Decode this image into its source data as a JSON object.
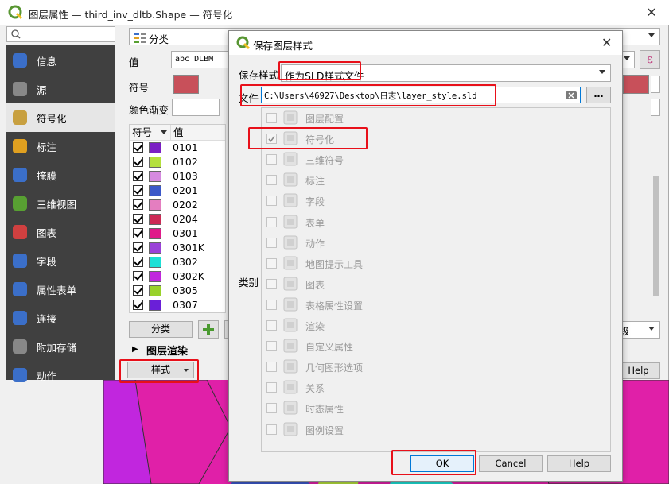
{
  "main_window": {
    "title": "图层属性 — third_inv_dltb.Shape — 符号化",
    "sidebar": [
      {
        "label": "信息",
        "icon": "info-icon"
      },
      {
        "label": "源",
        "icon": "source-icon"
      },
      {
        "label": "符号化",
        "icon": "symbology-icon",
        "selected": true
      },
      {
        "label": "标注",
        "icon": "labels-icon"
      },
      {
        "label": "掩膜",
        "icon": "mask-icon"
      },
      {
        "label": "三维视图",
        "icon": "3d-view-icon"
      },
      {
        "label": "图表",
        "icon": "diagrams-icon"
      },
      {
        "label": "字段",
        "icon": "fields-icon"
      },
      {
        "label": "属性表单",
        "icon": "attributes-form-icon"
      },
      {
        "label": "连接",
        "icon": "joins-icon"
      },
      {
        "label": "附加存储",
        "icon": "auxiliary-storage-icon"
      },
      {
        "label": "动作",
        "icon": "actions-icon"
      }
    ],
    "renderer_type": "分类",
    "value_label": "值",
    "value_field": "abc DLBM",
    "symbol_label": "符号",
    "color_ramp_label": "颜色渐变",
    "list_header_symbol": "符号",
    "list_header_value": "值",
    "rows": [
      {
        "value": "0101",
        "color": "#7a1fc4"
      },
      {
        "value": "0102",
        "color": "#b4e03c"
      },
      {
        "value": "0103",
        "color": "#d68ae0"
      },
      {
        "value": "0201",
        "color": "#3b58c9"
      },
      {
        "value": "0202",
        "color": "#e47ec0"
      },
      {
        "value": "0204",
        "color": "#cc2a55"
      },
      {
        "value": "0301",
        "color": "#e01a8a"
      },
      {
        "value": "0301K",
        "color": "#9a42d8"
      },
      {
        "value": "0302",
        "color": "#1de0d6"
      },
      {
        "value": "0302K",
        "color": "#c126de"
      },
      {
        "value": "0305",
        "color": "#99d22a"
      },
      {
        "value": "0307",
        "color": "#6a1fd8"
      }
    ],
    "classify_button": "分类",
    "layer_rendering": "图层渲染",
    "style_button": "样式",
    "advanced_label": "级",
    "help_label": "Help",
    "symbol_color": "#c8505a"
  },
  "dialog": {
    "title": "保存图层样式",
    "save_style_label": "保存样式",
    "save_style_value": "作为SLD样式文件",
    "file_label": "文件",
    "file_path": "C:\\Users\\46927\\Desktop\\日志\\layer_style.sld",
    "browse_label": "…",
    "category_label": "类别",
    "categories": [
      {
        "label": "图层配置",
        "checked": false,
        "icon": "layer-config-icon"
      },
      {
        "label": "符号化",
        "checked": true,
        "icon": "symbology-icon"
      },
      {
        "label": "三维符号",
        "checked": false,
        "icon": "3d-symbol-icon"
      },
      {
        "label": "标注",
        "checked": false,
        "icon": "labels-icon"
      },
      {
        "label": "字段",
        "checked": false,
        "icon": "fields-icon"
      },
      {
        "label": "表单",
        "checked": false,
        "icon": "form-icon"
      },
      {
        "label": "动作",
        "checked": false,
        "icon": "actions-icon"
      },
      {
        "label": "地图提示工具",
        "checked": false,
        "icon": "map-tips-icon"
      },
      {
        "label": "图表",
        "checked": false,
        "icon": "diagrams-icon"
      },
      {
        "label": "表格属性设置",
        "checked": false,
        "icon": "table-config-icon"
      },
      {
        "label": "渲染",
        "checked": false,
        "icon": "rendering-icon"
      },
      {
        "label": "自定义属性",
        "checked": false,
        "icon": "custom-properties-icon"
      },
      {
        "label": "几何图形选项",
        "checked": false,
        "icon": "geometry-options-icon"
      },
      {
        "label": "关系",
        "checked": false,
        "icon": "relations-icon"
      },
      {
        "label": "时态属性",
        "checked": false,
        "icon": "temporal-icon"
      },
      {
        "label": "图例设置",
        "checked": false,
        "icon": "legend-icon"
      }
    ],
    "ok_label": "OK",
    "cancel_label": "Cancel",
    "help_label": "Help"
  }
}
